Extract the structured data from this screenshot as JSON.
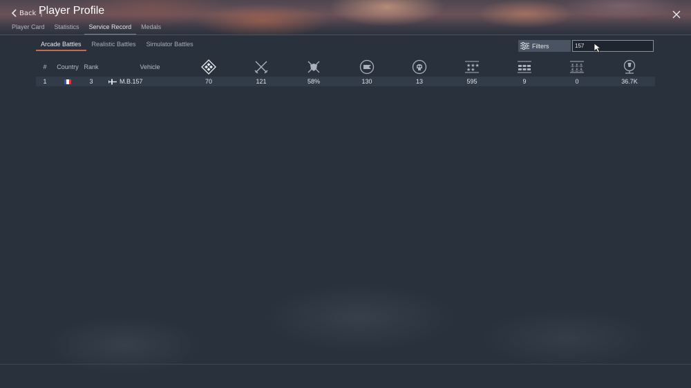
{
  "window": {
    "back_label": "Back",
    "separator": "|",
    "title": "Player Profile"
  },
  "tabs": [
    {
      "label": "Player Card",
      "active": false
    },
    {
      "label": "Statistics",
      "active": false
    },
    {
      "label": "Service Record",
      "active": true
    },
    {
      "label": "Medals",
      "active": false
    }
  ],
  "subtabs": [
    {
      "label": "Arcade Battles",
      "active": true
    },
    {
      "label": "Realistic Battles",
      "active": false
    },
    {
      "label": "Simulator Battles",
      "active": false
    }
  ],
  "filters": {
    "label": "Filters",
    "icon": "sliders-icon"
  },
  "search": {
    "value": "157"
  },
  "table": {
    "columns": [
      {
        "key": "index",
        "label": "#"
      },
      {
        "key": "country",
        "label": "Country"
      },
      {
        "key": "rank",
        "label": "Rank"
      },
      {
        "key": "vehicle",
        "label": "Vehicle"
      },
      {
        "key": "victories",
        "icon": "victories-icon"
      },
      {
        "key": "battles",
        "icon": "crossed-swords-icon"
      },
      {
        "key": "win_rate",
        "icon": "shield-swords-icon"
      },
      {
        "key": "respawns",
        "icon": "flag-icon"
      },
      {
        "key": "deaths",
        "icon": "skull-icon"
      },
      {
        "key": "air_targets",
        "icon": "stars-icon"
      },
      {
        "key": "ground_targets",
        "icon": "tanks-icon"
      },
      {
        "key": "naval_targets",
        "icon": "anchors-icon"
      },
      {
        "key": "activity",
        "icon": "balloon-icon"
      }
    ],
    "rows": [
      {
        "index": "1",
        "country": "France",
        "rank": "3",
        "vehicle": "M.B.157",
        "vehicle_icon": "plane-icon",
        "victories": "70",
        "battles": "121",
        "win_rate": "58%",
        "respawns": "130",
        "deaths": "13",
        "air_targets": "595",
        "ground_targets": "9",
        "naval_targets": "0",
        "activity": "36.7K"
      }
    ]
  },
  "colors": {
    "accent": "#c66a55",
    "background": "#29313d",
    "row": "#323b48",
    "flag_blue": "#2f56c8",
    "flag_white": "#ffffff",
    "flag_red": "#e0323a"
  }
}
